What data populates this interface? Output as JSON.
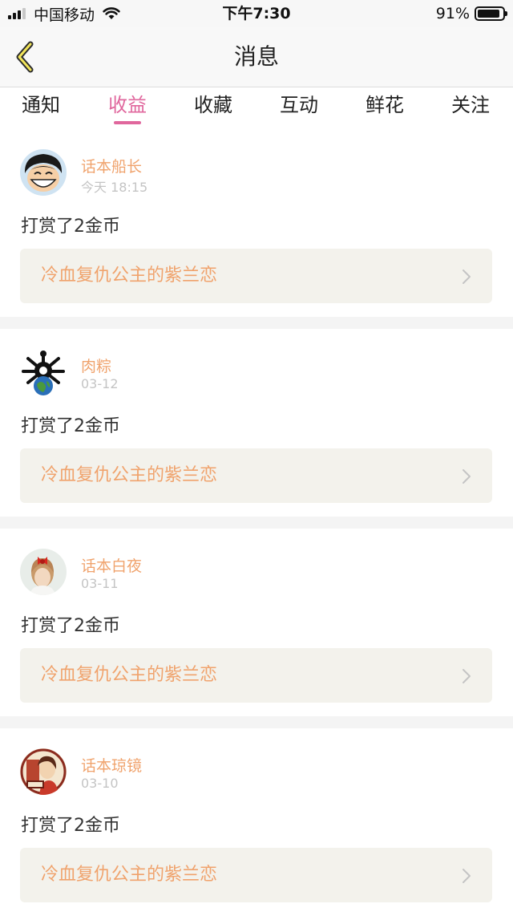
{
  "status_bar": {
    "carrier": "中国移动",
    "time": "下午7:30",
    "battery_percent": "91%",
    "battery_level": 0.91,
    "signal_bars": 4,
    "signal_active": 3
  },
  "header": {
    "title": "消息",
    "back_icon": "chevron-left-icon"
  },
  "tabs": [
    {
      "label": "通知",
      "active": false
    },
    {
      "label": "收益",
      "active": true
    },
    {
      "label": "收藏",
      "active": false
    },
    {
      "label": "互动",
      "active": false
    },
    {
      "label": "鲜花",
      "active": false
    },
    {
      "label": "关注",
      "active": false
    }
  ],
  "colors": {
    "accent_pink": "#e0679d",
    "username_orange": "#f0a36d",
    "book_bg": "#f3f2ec"
  },
  "messages": [
    {
      "username": "话本船长",
      "date": "今天 18:15",
      "text": "打赏了2金币",
      "book": "冷血复仇公主的紫兰恋",
      "avatar": "cartoon-boy-avatar"
    },
    {
      "username": "肉粽",
      "date": "03-12",
      "text": "打赏了2金币",
      "book": "冷血复仇公主的紫兰恋",
      "avatar": "globe-character-avatar"
    },
    {
      "username": "话本白夜",
      "date": "03-11",
      "text": "打赏了2金币",
      "book": "冷血复仇公主的紫兰恋",
      "avatar": "girl-red-bow-avatar"
    },
    {
      "username": "话本琼镜",
      "date": "03-10",
      "text": "打赏了2金币",
      "book": "冷血复仇公主的紫兰恋",
      "avatar": "illustrated-portrait-avatar"
    }
  ]
}
